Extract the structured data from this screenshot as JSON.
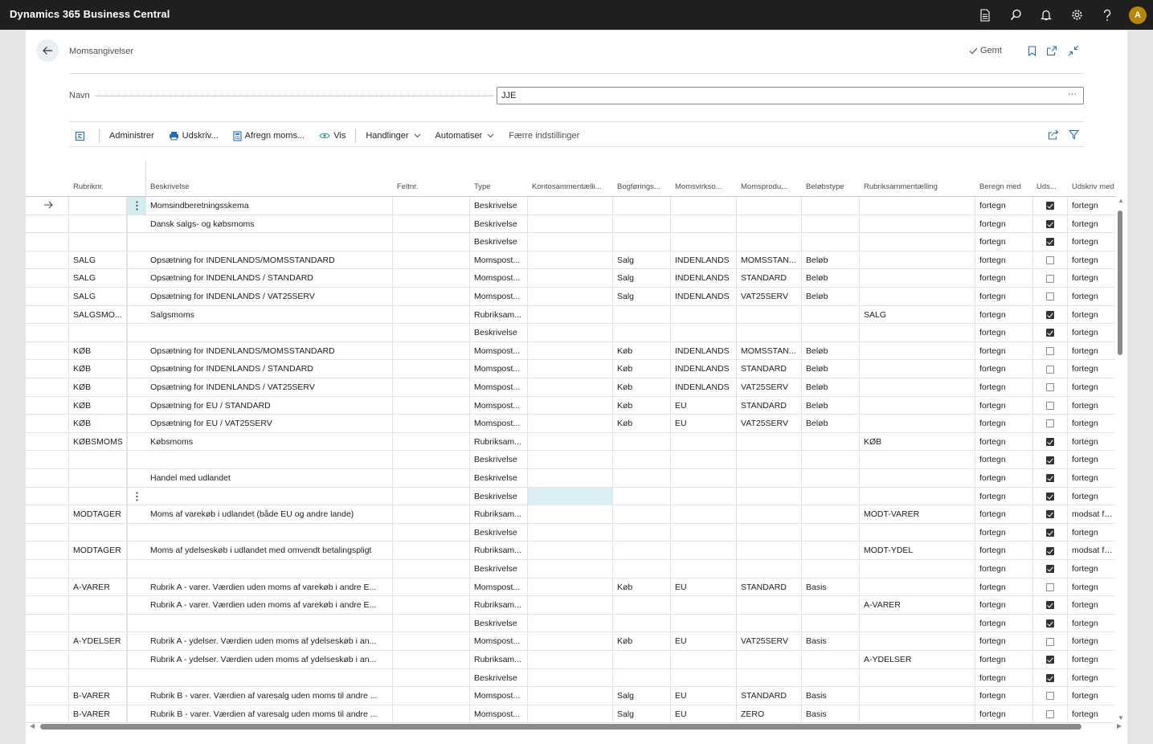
{
  "app": {
    "title": "Dynamics 365 Business Central",
    "user_initial": "A"
  },
  "top_icons": [
    "document-icon",
    "search-icon",
    "bell-icon",
    "gear-icon",
    "help-icon"
  ],
  "page": {
    "title": "Momsangivelser",
    "saved_label": "Gemt",
    "name_label": "Navn",
    "name_value": "JJE"
  },
  "toolbar": {
    "items": [
      {
        "label": "Administrer",
        "icon": "",
        "chevron": false
      },
      {
        "label": "Udskriv...",
        "icon": "printer-icon",
        "chevron": false
      },
      {
        "label": "Afregn moms...",
        "icon": "calculator-icon",
        "chevron": false
      },
      {
        "label": "Vis",
        "icon": "eye-icon",
        "chevron": false
      },
      {
        "label": "Handlinger",
        "icon": "",
        "chevron": true
      },
      {
        "label": "Automatiser",
        "icon": "",
        "chevron": true
      },
      {
        "label": "Færre indstillinger",
        "icon": "",
        "chevron": false
      }
    ]
  },
  "grid": {
    "columns": [
      "Rubriknr.",
      "Beskrivelse",
      "Feltnr.",
      "Type",
      "Kontosammentælli...",
      "Bogførings...",
      "Momsvirkso...",
      "Momsprodu...",
      "Beløbstype",
      "Rubriksammentælling",
      "Beregn med",
      "Uds...",
      "Udskriv med"
    ],
    "rows": [
      {
        "rubrik": "",
        "beskrivelse": "Momsindberetningsskema",
        "felt": "",
        "type": "Beskrivelse",
        "konto": "",
        "bogf": "",
        "virk": "",
        "prod": "",
        "belob": "",
        "rubsum": "",
        "beregn": "fortegn",
        "uds": true,
        "udskriv": "fortegn"
      },
      {
        "rubrik": "",
        "beskrivelse": "Dansk salgs- og købsmoms",
        "felt": "",
        "type": "Beskrivelse",
        "konto": "",
        "bogf": "",
        "virk": "",
        "prod": "",
        "belob": "",
        "rubsum": "",
        "beregn": "fortegn",
        "uds": true,
        "udskriv": "fortegn"
      },
      {
        "rubrik": "",
        "beskrivelse": "",
        "felt": "",
        "type": "Beskrivelse",
        "konto": "",
        "bogf": "",
        "virk": "",
        "prod": "",
        "belob": "",
        "rubsum": "",
        "beregn": "fortegn",
        "uds": true,
        "udskriv": "fortegn"
      },
      {
        "rubrik": "SALG",
        "beskrivelse": "Opsætning for INDENLANDS/MOMSSTANDARD",
        "felt": "",
        "type": "Momspost...",
        "konto": "",
        "bogf": "Salg",
        "virk": "INDENLANDS",
        "prod": "MOMSSTAN...",
        "belob": "Beløb",
        "rubsum": "",
        "beregn": "fortegn",
        "uds": false,
        "udskriv": "fortegn"
      },
      {
        "rubrik": "SALG",
        "beskrivelse": "Opsætning for INDENLANDS / STANDARD",
        "felt": "",
        "type": "Momspost...",
        "konto": "",
        "bogf": "Salg",
        "virk": "INDENLANDS",
        "prod": "STANDARD",
        "belob": "Beløb",
        "rubsum": "",
        "beregn": "fortegn",
        "uds": false,
        "udskriv": "fortegn"
      },
      {
        "rubrik": "SALG",
        "beskrivelse": "Opsætning for INDENLANDS / VAT25SERV",
        "felt": "",
        "type": "Momspost...",
        "konto": "",
        "bogf": "Salg",
        "virk": "INDENLANDS",
        "prod": "VAT25SERV",
        "belob": "Beløb",
        "rubsum": "",
        "beregn": "fortegn",
        "uds": false,
        "udskriv": "fortegn"
      },
      {
        "rubrik": "SALGSMO...",
        "beskrivelse": "Salgsmoms",
        "felt": "",
        "type": "Rubriksam...",
        "konto": "",
        "bogf": "",
        "virk": "",
        "prod": "",
        "belob": "",
        "rubsum": "SALG",
        "beregn": "fortegn",
        "uds": true,
        "udskriv": "fortegn"
      },
      {
        "rubrik": "",
        "beskrivelse": "",
        "felt": "",
        "type": "Beskrivelse",
        "konto": "",
        "bogf": "",
        "virk": "",
        "prod": "",
        "belob": "",
        "rubsum": "",
        "beregn": "fortegn",
        "uds": true,
        "udskriv": "fortegn"
      },
      {
        "rubrik": "KØB",
        "beskrivelse": "Opsætning for INDENLANDS/MOMSSTANDARD",
        "felt": "",
        "type": "Momspost...",
        "konto": "",
        "bogf": "Køb",
        "virk": "INDENLANDS",
        "prod": "MOMSSTAN...",
        "belob": "Beløb",
        "rubsum": "",
        "beregn": "fortegn",
        "uds": false,
        "udskriv": "fortegn"
      },
      {
        "rubrik": "KØB",
        "beskrivelse": "Opsætning for INDENLANDS / STANDARD",
        "felt": "",
        "type": "Momspost...",
        "konto": "",
        "bogf": "Køb",
        "virk": "INDENLANDS",
        "prod": "STANDARD",
        "belob": "Beløb",
        "rubsum": "",
        "beregn": "fortegn",
        "uds": false,
        "udskriv": "fortegn"
      },
      {
        "rubrik": "KØB",
        "beskrivelse": "Opsætning for INDENLANDS / VAT25SERV",
        "felt": "",
        "type": "Momspost...",
        "konto": "",
        "bogf": "Køb",
        "virk": "INDENLANDS",
        "prod": "VAT25SERV",
        "belob": "Beløb",
        "rubsum": "",
        "beregn": "fortegn",
        "uds": false,
        "udskriv": "fortegn"
      },
      {
        "rubrik": "KØB",
        "beskrivelse": "Opsætning for EU / STANDARD",
        "felt": "",
        "type": "Momspost...",
        "konto": "",
        "bogf": "Køb",
        "virk": "EU",
        "prod": "STANDARD",
        "belob": "Beløb",
        "rubsum": "",
        "beregn": "fortegn",
        "uds": false,
        "udskriv": "fortegn"
      },
      {
        "rubrik": "KØB",
        "beskrivelse": "Opsætning for EU / VAT25SERV",
        "felt": "",
        "type": "Momspost...",
        "konto": "",
        "bogf": "Køb",
        "virk": "EU",
        "prod": "VAT25SERV",
        "belob": "Beløb",
        "rubsum": "",
        "beregn": "fortegn",
        "uds": false,
        "udskriv": "fortegn"
      },
      {
        "rubrik": "KØBSMOMS",
        "beskrivelse": "Købsmoms",
        "felt": "",
        "type": "Rubriksam...",
        "konto": "",
        "bogf": "",
        "virk": "",
        "prod": "",
        "belob": "",
        "rubsum": "KØB",
        "beregn": "fortegn",
        "uds": true,
        "udskriv": "fortegn"
      },
      {
        "rubrik": "",
        "beskrivelse": "",
        "felt": "",
        "type": "Beskrivelse",
        "konto": "",
        "bogf": "",
        "virk": "",
        "prod": "",
        "belob": "",
        "rubsum": "",
        "beregn": "fortegn",
        "uds": true,
        "udskriv": "fortegn"
      },
      {
        "rubrik": "",
        "beskrivelse": "Handel med udlandet",
        "felt": "",
        "type": "Beskrivelse",
        "konto": "",
        "bogf": "",
        "virk": "",
        "prod": "",
        "belob": "",
        "rubsum": "",
        "beregn": "fortegn",
        "uds": true,
        "udskriv": "fortegn"
      },
      {
        "rubrik": "",
        "beskrivelse": "",
        "felt": "",
        "type": "Beskrivelse",
        "konto": "",
        "bogf": "",
        "virk": "",
        "prod": "",
        "belob": "",
        "rubsum": "",
        "beregn": "fortegn",
        "uds": true,
        "udskriv": "fortegn"
      },
      {
        "rubrik": "MODTAGER",
        "beskrivelse": "Moms af varekøb i udlandet (både EU og andre lande)",
        "felt": "",
        "type": "Rubriksam...",
        "konto": "",
        "bogf": "",
        "virk": "",
        "prod": "",
        "belob": "",
        "rubsum": "MODT-VARER",
        "beregn": "fortegn",
        "uds": true,
        "udskriv": "modsat fortegn"
      },
      {
        "rubrik": "",
        "beskrivelse": "",
        "felt": "",
        "type": "Beskrivelse",
        "konto": "",
        "bogf": "",
        "virk": "",
        "prod": "",
        "belob": "",
        "rubsum": "",
        "beregn": "fortegn",
        "uds": true,
        "udskriv": "fortegn"
      },
      {
        "rubrik": "MODTAGER",
        "beskrivelse": "Moms af ydelseskøb i udlandet med omvendt betalingspligt",
        "felt": "",
        "type": "Rubriksam...",
        "konto": "",
        "bogf": "",
        "virk": "",
        "prod": "",
        "belob": "",
        "rubsum": "MODT-YDEL",
        "beregn": "fortegn",
        "uds": true,
        "udskriv": "modsat fortegn"
      },
      {
        "rubrik": "",
        "beskrivelse": "",
        "felt": "",
        "type": "Beskrivelse",
        "konto": "",
        "bogf": "",
        "virk": "",
        "prod": "",
        "belob": "",
        "rubsum": "",
        "beregn": "fortegn",
        "uds": true,
        "udskriv": "fortegn"
      },
      {
        "rubrik": "A-VARER",
        "beskrivelse": "Rubrik A - varer. Værdien uden moms af varekøb i andre E...",
        "felt": "",
        "type": "Momspost...",
        "konto": "",
        "bogf": "Køb",
        "virk": "EU",
        "prod": "STANDARD",
        "belob": "Basis",
        "rubsum": "",
        "beregn": "fortegn",
        "uds": false,
        "udskriv": "fortegn"
      },
      {
        "rubrik": "",
        "beskrivelse": "Rubrik A - varer. Værdien uden moms af varekøb i andre E...",
        "felt": "",
        "type": "Rubriksam...",
        "konto": "",
        "bogf": "",
        "virk": "",
        "prod": "",
        "belob": "",
        "rubsum": "A-VARER",
        "beregn": "fortegn",
        "uds": true,
        "udskriv": "fortegn"
      },
      {
        "rubrik": "",
        "beskrivelse": "",
        "felt": "",
        "type": "Beskrivelse",
        "konto": "",
        "bogf": "",
        "virk": "",
        "prod": "",
        "belob": "",
        "rubsum": "",
        "beregn": "fortegn",
        "uds": true,
        "udskriv": "fortegn"
      },
      {
        "rubrik": "A-YDELSER",
        "beskrivelse": "Rubrik A - ydelser. Værdien uden moms af ydelseskøb i an...",
        "felt": "",
        "type": "Momspost...",
        "konto": "",
        "bogf": "Køb",
        "virk": "EU",
        "prod": "VAT25SERV",
        "belob": "Basis",
        "rubsum": "",
        "beregn": "fortegn",
        "uds": false,
        "udskriv": "fortegn"
      },
      {
        "rubrik": "",
        "beskrivelse": "Rubrik A - ydelser. Værdien uden moms af ydelseskøb i an...",
        "felt": "",
        "type": "Rubriksam...",
        "konto": "",
        "bogf": "",
        "virk": "",
        "prod": "",
        "belob": "",
        "rubsum": "A-YDELSER",
        "beregn": "fortegn",
        "uds": true,
        "udskriv": "fortegn"
      },
      {
        "rubrik": "",
        "beskrivelse": "",
        "felt": "",
        "type": "Beskrivelse",
        "konto": "",
        "bogf": "",
        "virk": "",
        "prod": "",
        "belob": "",
        "rubsum": "",
        "beregn": "fortegn",
        "uds": true,
        "udskriv": "fortegn"
      },
      {
        "rubrik": "B-VARER",
        "beskrivelse": "Rubrik B - varer. Værdien af varesalg uden moms til andre ...",
        "felt": "",
        "type": "Momspost...",
        "konto": "",
        "bogf": "Salg",
        "virk": "EU",
        "prod": "STANDARD",
        "belob": "Basis",
        "rubsum": "",
        "beregn": "fortegn",
        "uds": false,
        "udskriv": "fortegn"
      },
      {
        "rubrik": "B-VARER",
        "beskrivelse": "Rubrik B - varer. Værdien af varesalg uden moms til andre ...",
        "felt": "",
        "type": "Momspost...",
        "konto": "",
        "bogf": "Salg",
        "virk": "EU",
        "prod": "ZERO",
        "belob": "Basis",
        "rubsum": "",
        "beregn": "fortegn",
        "uds": false,
        "udskriv": "fortegn"
      }
    ]
  }
}
